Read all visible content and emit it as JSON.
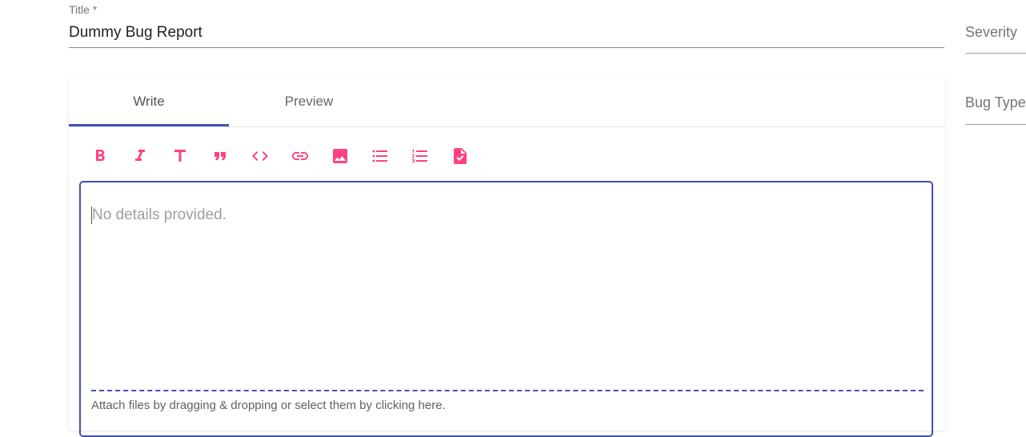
{
  "title_field": {
    "label": "Title *",
    "value": "Dummy Bug Report"
  },
  "side_fields": {
    "severity_label": "Severity",
    "bug_type_label": "Bug Type"
  },
  "editor": {
    "tabs": [
      {
        "label": "Write",
        "active": true
      },
      {
        "label": "Preview",
        "active": false
      }
    ],
    "toolbar_icons": [
      "bold-icon",
      "italic-icon",
      "header-icon",
      "quote-icon",
      "code-icon",
      "link-icon",
      "image-icon",
      "unordered-list-icon",
      "ordered-list-icon",
      "checked-list-icon"
    ],
    "placeholder": "No details provided.",
    "attach_text": "Attach files by dragging & dropping or select them by clicking here."
  },
  "colors": {
    "accent": "#3f51b5",
    "icon": "#ff4081"
  }
}
